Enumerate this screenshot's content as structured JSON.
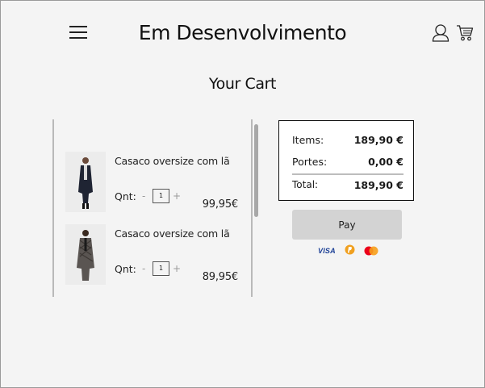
{
  "header": {
    "title": "Em Desenvolvimento",
    "menu_icon": "hamburger-menu-icon",
    "user_icon": "user-icon",
    "cart_icon": "shopping-cart-icon"
  },
  "cart": {
    "heading": "Your Cart",
    "quantity_label": "Qnt:",
    "minus_symbol": "-",
    "plus_symbol": "+",
    "items": [
      {
        "name": "Casaco oversize com lã",
        "quantity": "1",
        "price": "99,95€"
      },
      {
        "name": "Casaco oversize com lã",
        "quantity": "1",
        "price": "89,95€"
      }
    ]
  },
  "summary": {
    "items_label": "Items:",
    "items_value": "189,90 €",
    "shipping_label": "Portes:",
    "shipping_value": "0,00 €",
    "total_label": "Total:",
    "total_value": "189,90 €"
  },
  "payment": {
    "pay_label": "Pay",
    "visa_text": "VISA",
    "methods": [
      "visa-icon",
      "paypal-icon",
      "mastercard-icon"
    ]
  },
  "colors": {
    "background": "#f4f4f4",
    "button": "#d3d3d3",
    "visa_blue": "#1a3e95",
    "paypal_orange": "#f0a020",
    "mastercard_red": "#eb001b",
    "mastercard_orange": "#f79e1b"
  }
}
